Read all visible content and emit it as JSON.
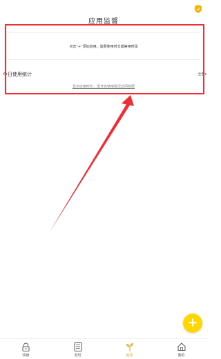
{
  "status": {
    "shield_icon": "shield-icon"
  },
  "header": {
    "title": "应用监督"
  },
  "hint_card": {
    "text": "点击“+”添加应用，监督使用时长或禁用时段"
  },
  "usage": {
    "title": "今日使用统计",
    "filter_label": "全部",
    "permission_link": "显示应用时长，需开启使用情况访问权限"
  },
  "fab": {
    "icon": "plus-icon"
  },
  "bottom_nav": {
    "items": [
      {
        "label": "快锁",
        "icon": "lock-icon",
        "active": false
      },
      {
        "label": "定时",
        "icon": "list-icon",
        "active": false
      },
      {
        "label": "监督",
        "icon": "sprout-icon",
        "active": true
      },
      {
        "label": "我的",
        "icon": "home-icon",
        "active": false
      }
    ]
  },
  "colors": {
    "highlight": "#ee2e35",
    "accent_yellow": "#ffd600",
    "active_nav": "#d9b13a"
  }
}
